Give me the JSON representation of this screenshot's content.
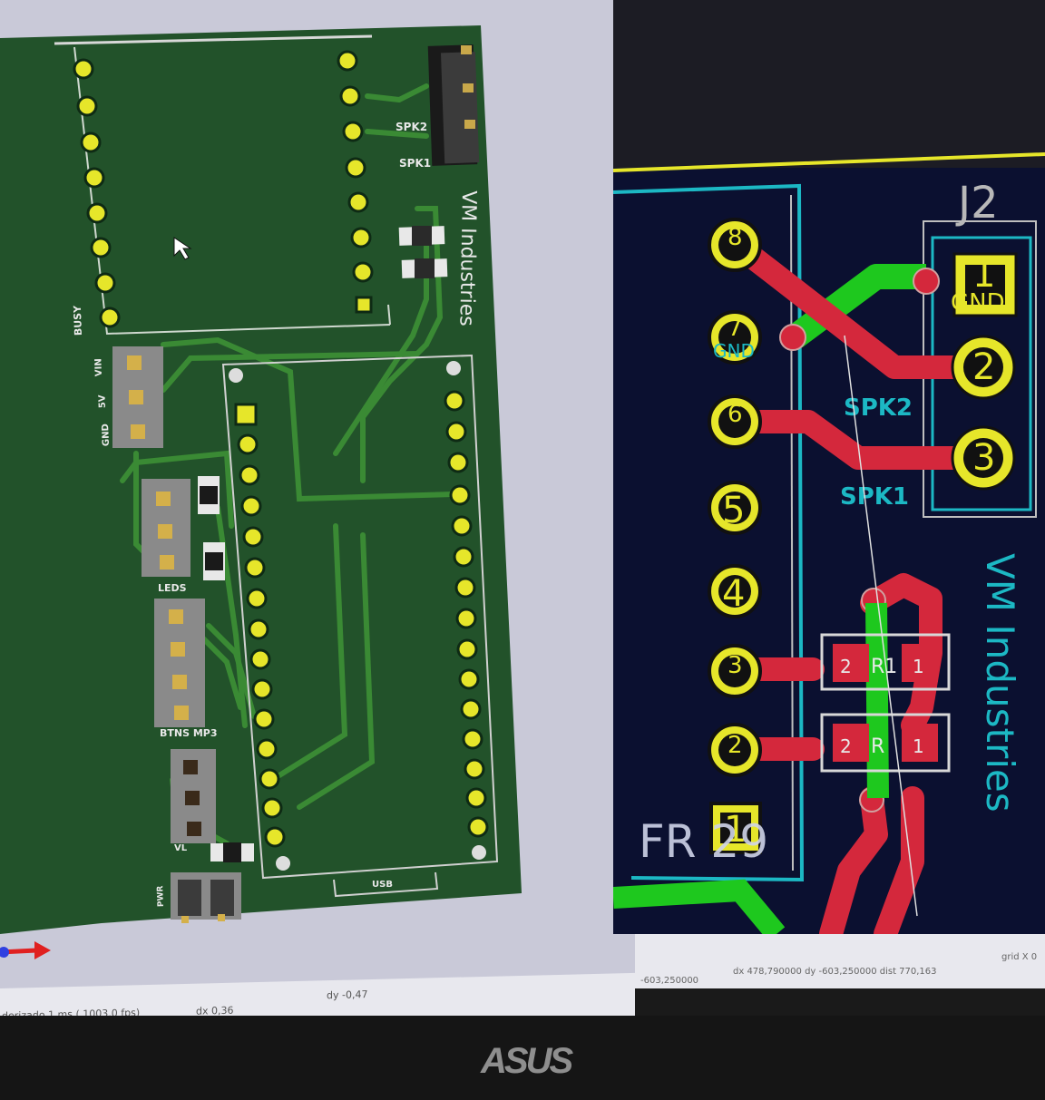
{
  "viewer3d": {
    "status_left": "derizado 1 ms ( 1003,0 fps)",
    "status_dx": "dx 0,36",
    "status_dy": "dy -0,47"
  },
  "board": {
    "brand": "VM Industries",
    "labels": {
      "busy": "BUSY",
      "vin": "VIN",
      "v5": "5V",
      "gnd": "GND",
      "leds": "LEDS",
      "btns_mp3": "BTNS MP3",
      "vl": "VL",
      "pwr": "PWR",
      "usb": "USB",
      "spk2": "SPK2",
      "spk1": "SPK1"
    }
  },
  "pcb": {
    "ref_j2": "J2",
    "pin_labels": [
      "1",
      "2",
      "3",
      "4",
      "5",
      "6",
      "7",
      "8"
    ],
    "gnd_label": "GND",
    "j2_pin1": "1",
    "j2_pin2": "2",
    "j2_pin3": "3",
    "spk2": "SPK2",
    "spk1": "SPK1",
    "brand": "VM Industries",
    "ref_r1": "R1",
    "ref_r2": "R",
    "pad_1": "1",
    "pad_2": "2",
    "silk_fragment": "FR 29",
    "status_1": "-603,250000",
    "status_2": "dx 478,790000  dy -603,250000  dist 770,163",
    "status_3": "grid X 0"
  },
  "monitor": {
    "logo": "ASUS"
  },
  "colors": {
    "board_green": "#22522a",
    "pad_yellow": "#e6e62a",
    "track_red": "#d4283c",
    "track_green": "#1ec81e",
    "silk_cyan": "#1cb8c4",
    "pcb_bg": "#0b1030"
  }
}
